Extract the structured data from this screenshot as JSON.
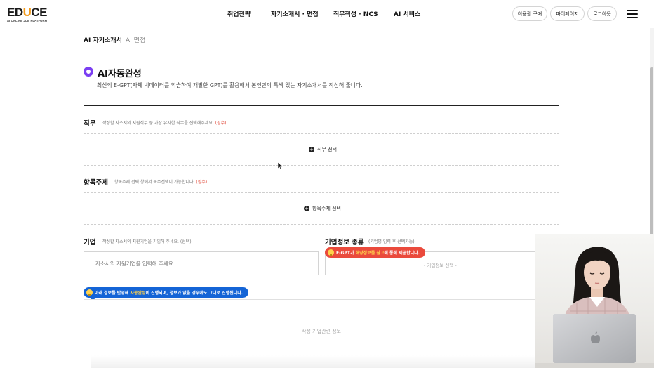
{
  "brand": {
    "logo_main_prefix": "ED",
    "logo_main_accent": "U",
    "logo_main_suffix": "CE",
    "logo_sub": "AI ONLINE JOB PLATFORM"
  },
  "nav": {
    "items": [
      "취업전략",
      "자기소개서 · 면접",
      "직무적성 · NCS",
      "AI 서비스"
    ]
  },
  "header_buttons": {
    "purchase": "이용권 구매",
    "mypage": "마이페이지",
    "logout": "로그아웃"
  },
  "subtabs": {
    "active": "AI 자기소개서",
    "inactive": "AI 면접"
  },
  "section": {
    "title": "AI자동완성",
    "description": "최신의 E-GPT(자체 빅데이터를 학습하여 개발한 GPT)를 활용해서 본인만의 특색 있는 자기소개서를 작성해 줍니다."
  },
  "job": {
    "label": "직무",
    "hint": "작성할 자소서의 지원직무 중 가장 유사한 직무를 선택해주세요.",
    "required": "(필수)",
    "button": "직무 선택"
  },
  "topic": {
    "label": "항목주제",
    "hint": "항목주제 선택 창에서 복수선택이 가능합니다.",
    "required": "(필수)",
    "button": "항목주제 선택"
  },
  "company": {
    "label": "기업",
    "hint": "작성할 자소서의 지원기업을 기입해 주세요.",
    "optional": "(선택)",
    "placeholder": "자소서의 지원기업을 입력해 주세요"
  },
  "company_info": {
    "label": "기업정보 종류",
    "hint": "(기업명 입력 후 선택가능)",
    "tip_prefix": "E-GPT가 ",
    "tip_highlight": "해당정보를 참고",
    "tip_suffix": "해 통해 제공합니다.",
    "select_placeholder": "- 기업정보 선택 -"
  },
  "info_notice": {
    "prefix": "아래 정보를 반영해 ",
    "highlight": "자동완성",
    "suffix": "이 진행되며, 정보가 없을 경우에도 그대로 진행됩니다."
  },
  "company_related": {
    "placeholder": "작성 기업관련 정보"
  },
  "colors": {
    "accent_purple": "#7b3ff2",
    "logo_orange": "#f29a1a",
    "required_red": "#e04a3a",
    "tip_red": "#ea4a3c",
    "tip_blue": "#1464d6"
  }
}
